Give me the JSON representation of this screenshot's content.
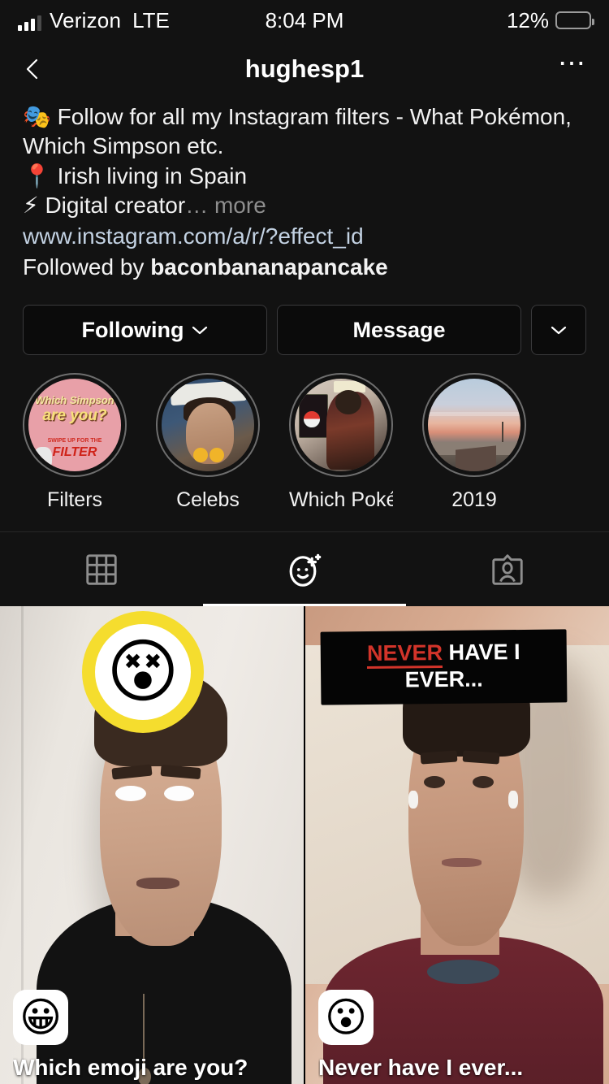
{
  "status_bar": {
    "carrier": "Verizon",
    "network": "LTE",
    "time": "8:04 PM",
    "battery_percent": "12%",
    "battery_level": 12,
    "battery_color": "#f5c518",
    "signal_bars_filled": 3,
    "signal_bars_total": 4
  },
  "header": {
    "username": "hughesp1",
    "back_icon": "back-chevron-icon",
    "more_icon": "more-options-icon"
  },
  "bio": {
    "line1_emoji": "🎭",
    "line1": "Follow for all my Instagram filters - What Pokémon, Which Simpson etc.",
    "line2_emoji": "📍",
    "line2": "Irish living in Spain",
    "line3_emoji": "⚡",
    "line3": "Digital creator",
    "ellipsis": "…",
    "more_label": "more",
    "url": "www.instagram.com/a/r/?effect_id",
    "followed_by_prefix": "Followed by ",
    "followed_by_name": "baconbananapancake",
    "url_color": "#c3d2e3",
    "more_color": "#8e8e8e"
  },
  "actions": {
    "following_label": "Following",
    "message_label": "Message",
    "caret_icon": "chevron-down-icon"
  },
  "highlights": [
    {
      "label": "Filters",
      "thumb": "which-simpson-pink-card",
      "card_text": {
        "t1": "Which Simpson",
        "t2": "are you?",
        "t3": "SWIPE UP FOR THE",
        "t4": "FILTER"
      }
    },
    {
      "label": "Celebs",
      "thumb": "celeb-selfie-photo"
    },
    {
      "label": "Which Poké…",
      "thumb": "pokemon-costume-photo"
    },
    {
      "label": "2019",
      "thumb": "sunset-rooftop-photo"
    }
  ],
  "tabs": [
    {
      "name": "posts-grid",
      "icon": "grid-icon",
      "active": false
    },
    {
      "name": "effects",
      "icon": "face-effects-icon",
      "active": true
    },
    {
      "name": "tagged",
      "icon": "tagged-person-icon",
      "active": false
    }
  ],
  "effects": [
    {
      "title": "Which emoji are you?",
      "badge_emoji": "😀",
      "badge_name": "grinning-face-badge",
      "overlay": {
        "type": "emoji-ring",
        "emoji": "😵",
        "ring_color": "#f5dd2e"
      }
    },
    {
      "title": "Never have I ever...",
      "badge_emoji": "😮",
      "badge_name": "open-mouth-face-badge",
      "overlay": {
        "type": "text-banner",
        "word_red": "NEVER",
        "line1_rest": " HAVE I",
        "line2": "EVER...",
        "red_color": "#d2342a"
      }
    }
  ],
  "theme": {
    "background": "#121212",
    "text": "#f2f2f2",
    "divider": "#262626"
  }
}
